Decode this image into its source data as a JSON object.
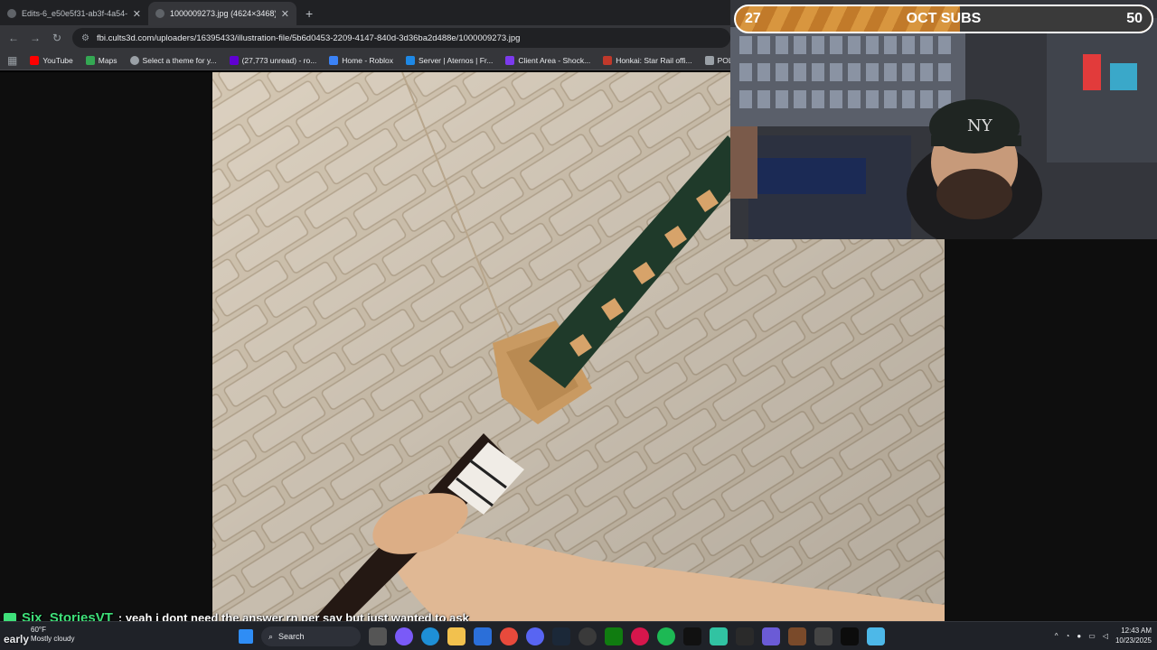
{
  "browser": {
    "tabs": [
      {
        "title": "Edits-6_e50e5f31-ab3f-4a54-9",
        "active": false
      },
      {
        "title": "1000009273.jpg (4624×3468)",
        "active": true
      }
    ],
    "new_tab": "+",
    "url": "fbi.cults3d.com/uploaders/16395433/illustration-file/5b6d0453-2209-4147-840d-3d36ba2d488e/1000009273.jpg",
    "bookmarks": [
      {
        "label": "YouTube",
        "color": "#ff0000"
      },
      {
        "label": "Maps",
        "color": "#34a853"
      },
      {
        "label": "Select a theme for y...",
        "color": "#9aa0a6"
      },
      {
        "label": "(27,773 unread) - ro...",
        "color": "#6001d2"
      },
      {
        "label": "Home - Roblox",
        "color": "#3b82f6"
      },
      {
        "label": "Server | Aternos | Fr...",
        "color": "#1e88e5"
      },
      {
        "label": "Client Area - Shock...",
        "color": "#7c3aed"
      },
      {
        "label": "Honkai: Star Rail offi...",
        "color": "#c0392b"
      },
      {
        "label": "POLYGON Sci-Fi C",
        "color": "#9aa0a6"
      }
    ]
  },
  "stream": {
    "sub_goal": {
      "current": "27",
      "label": "OCT SUBS",
      "target": "50",
      "progress": 0.54
    }
  },
  "chat": {
    "username": "Six_StoriesVT",
    "message": ": yeah i dont need the answer rn per say but just wanted to ask"
  },
  "taskbar": {
    "weather_temp": "60°F",
    "weather_desc": "Mostly cloudy",
    "overlay_text": "early",
    "search_label": "Search",
    "time": "12:43 AM",
    "date": "10/23/2025"
  },
  "colors": {
    "chat_name": "#3fe07a",
    "sub_bar": "#c17a2a"
  }
}
